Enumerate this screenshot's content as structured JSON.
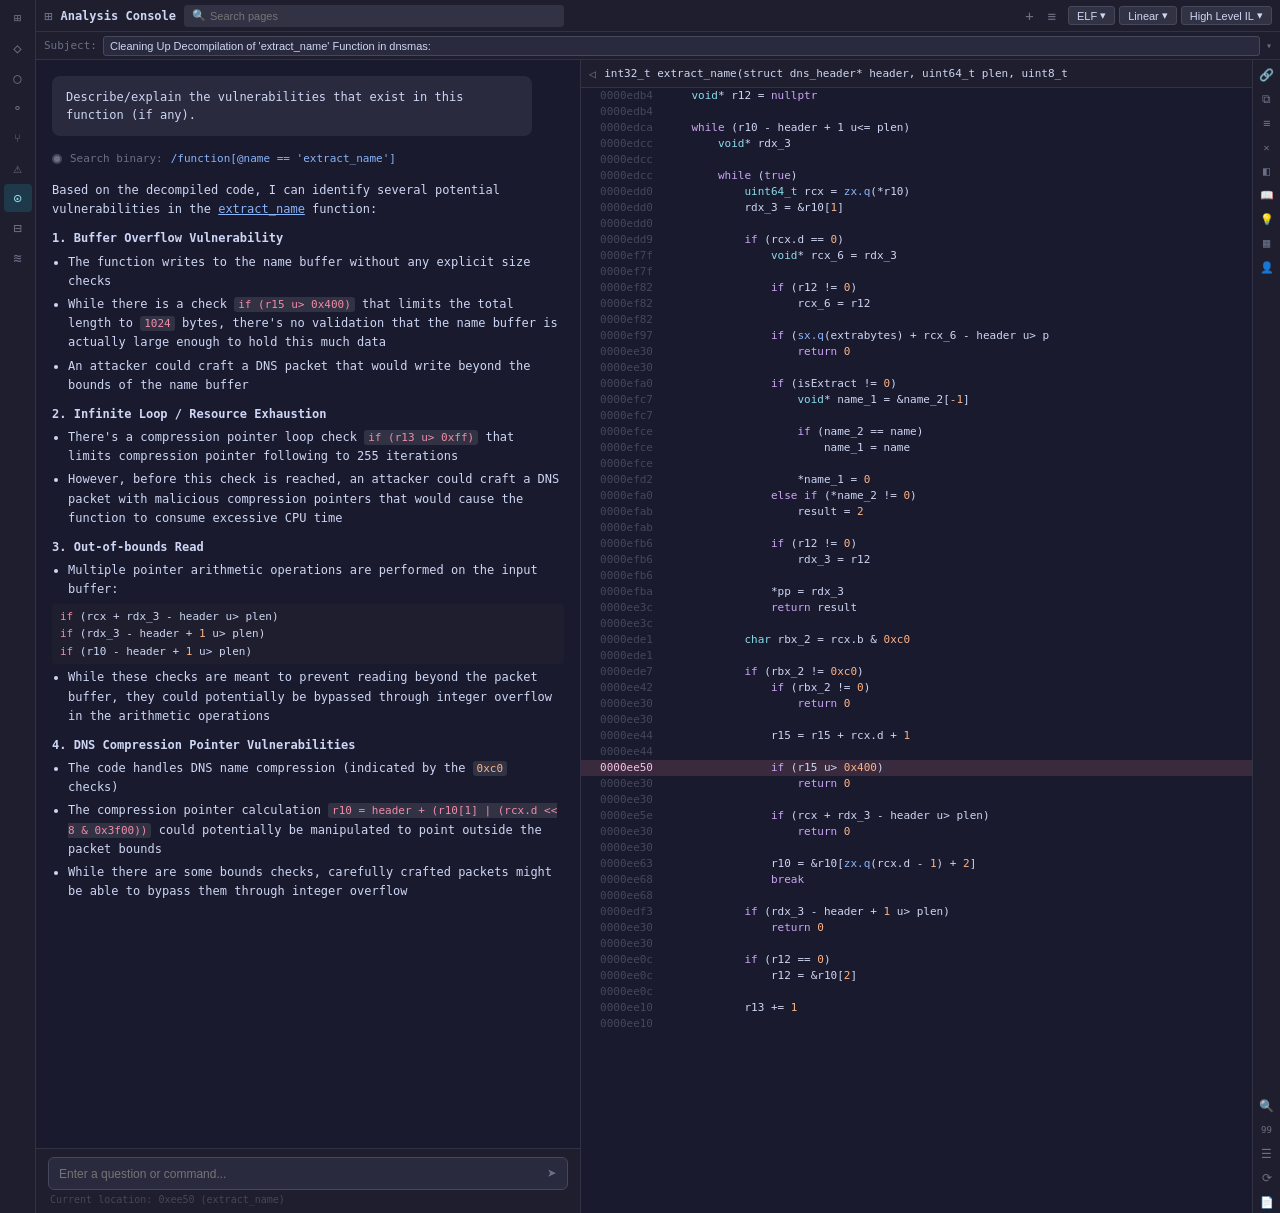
{
  "app": {
    "title": "Analysis Console",
    "search_placeholder": "Search pages"
  },
  "topbar": {
    "title": "Analysis Console",
    "search_placeholder": "Search pages",
    "tab_add": "+",
    "tab_menu": "≡",
    "elf_label": "ELF",
    "linear_label": "Linear",
    "highlevel_label": "High Level IL"
  },
  "subject": {
    "label": "Subject:",
    "value": "Cleaning Up Decompilation of 'extract_name' Function in dnsmas:"
  },
  "chat": {
    "bubble_text": "Describe/explain the vulnerabilities that exist in this function (if any).",
    "search_binary_text": "Search binary:",
    "search_query": "/function[@name == 'extract_name']",
    "response_intro": "Based on the decompiled code, I can identify several potential vulnerabilities in the",
    "func_name": "extract_name",
    "func_suffix": "function:",
    "sections": [
      {
        "num": "1.",
        "title": "Buffer Overflow Vulnerability",
        "bullets": [
          "The function writes to the name buffer without any explicit size checks",
          "While there is a check if (r15 u> 0x400) that limits the total length to 1024 bytes, there's no validation that the name buffer is actually large enough to hold this much data",
          "An attacker could craft a DNS packet that would write beyond the bounds of the name buffer"
        ]
      },
      {
        "num": "2.",
        "title": "Infinite Loop / Resource Exhaustion",
        "bullets": [
          "There's a compression pointer loop check if (r13 u> 0xff) that limits compression pointer following to 255 iterations",
          "However, before this check is reached, an attacker could craft a DNS packet with malicious compression pointers that would cause the function to consume excessive CPU time"
        ]
      },
      {
        "num": "3.",
        "title": "Out-of-bounds Read",
        "bullets": [
          "Multiple pointer arithmetic operations are performed on the input buffer:"
        ],
        "code_lines": [
          "if (rcx + rdx_3 - header u> plen)",
          "if (rdx_3 - header + 1 u> plen)",
          "if (r10 - header + 1 u> plen)"
        ],
        "extra_bullets": [
          "While these checks are meant to prevent reading beyond the packet buffer, they could potentially be bypassed through integer overflow in the arithmetic operations"
        ]
      },
      {
        "num": "4.",
        "title": "DNS Compression Pointer Vulnerabilities",
        "bullets": [
          "The code handles DNS name compression (indicated by the 0xc0 checks)",
          "The compression pointer calculation r10 = header + (r10[1] | (rcx.d << 8 & 0x3f00)) could potentially be manipulated to point outside the packet bounds",
          "While there are some bounds checks, carefully crafted packets might be able to bypass them through integer overflow"
        ]
      }
    ],
    "input_placeholder": "Enter a question or command...",
    "location_label": "Current location:",
    "location_value": "0xee50 (extract_name)"
  },
  "code_header": {
    "breadcrumb": "int32_t extract_name(struct dns_header* header, uint64_t plen, uint8_t"
  },
  "code_lines": [
    {
      "addr": "0000edb4",
      "content": "    void* r12 = nullptr",
      "highlight": false
    },
    {
      "addr": "0000edb4",
      "content": "",
      "highlight": false
    },
    {
      "addr": "0000edca",
      "content": "    while (r10 - header + 1 u<= plen)",
      "highlight": false
    },
    {
      "addr": "0000edcc",
      "content": "        void* rdx_3",
      "highlight": false
    },
    {
      "addr": "0000edcc",
      "content": "",
      "highlight": false
    },
    {
      "addr": "0000edcc",
      "content": "        while (true)",
      "highlight": false
    },
    {
      "addr": "0000edd0",
      "content": "            uint64_t rcx = zx.q(*r10)",
      "highlight": false
    },
    {
      "addr": "0000edd0",
      "content": "            rdx_3 = &r10[1]",
      "highlight": false
    },
    {
      "addr": "0000edd0",
      "content": "",
      "highlight": false
    },
    {
      "addr": "0000edd9",
      "content": "            if (rcx.d == 0)",
      "highlight": false
    },
    {
      "addr": "0000ef7f",
      "content": "                void* rcx_6 = rdx_3",
      "highlight": false
    },
    {
      "addr": "0000ef7f",
      "content": "",
      "highlight": false
    },
    {
      "addr": "0000ef82",
      "content": "                if (r12 != 0)",
      "highlight": false
    },
    {
      "addr": "0000ef82",
      "content": "                    rcx_6 = r12",
      "highlight": false
    },
    {
      "addr": "0000ef82",
      "content": "",
      "highlight": false
    },
    {
      "addr": "0000ef97",
      "content": "                if (sx.q(extrabytes) + rcx_6 - header u> p",
      "highlight": false
    },
    {
      "addr": "0000ee30",
      "content": "                    return 0",
      "highlight": false
    },
    {
      "addr": "0000ee30",
      "content": "",
      "highlight": false
    },
    {
      "addr": "0000efa0",
      "content": "                if (isExtract != 0)",
      "highlight": false
    },
    {
      "addr": "0000efc7",
      "content": "                    void* name_1 = &name_2[-1]",
      "highlight": false
    },
    {
      "addr": "0000efc7",
      "content": "",
      "highlight": false
    },
    {
      "addr": "0000efce",
      "content": "                    if (name_2 == name)",
      "highlight": false
    },
    {
      "addr": "0000efce",
      "content": "                        name_1 = name",
      "highlight": false
    },
    {
      "addr": "0000efce",
      "content": "",
      "highlight": false
    },
    {
      "addr": "0000efd2",
      "content": "                    *name_1 = 0",
      "highlight": false
    },
    {
      "addr": "0000efa0",
      "content": "                else if (*name_2 != 0)",
      "highlight": false
    },
    {
      "addr": "0000efab",
      "content": "                    result = 2",
      "highlight": false
    },
    {
      "addr": "0000efab",
      "content": "",
      "highlight": false
    },
    {
      "addr": "0000efb6",
      "content": "                if (r12 != 0)",
      "highlight": false
    },
    {
      "addr": "0000efb6",
      "content": "                    rdx_3 = r12",
      "highlight": false
    },
    {
      "addr": "0000efb6",
      "content": "",
      "highlight": false
    },
    {
      "addr": "0000efba",
      "content": "                *pp = rdx_3",
      "highlight": false
    },
    {
      "addr": "0000ee3c",
      "content": "                return result",
      "highlight": false
    },
    {
      "addr": "0000ee3c",
      "content": "",
      "highlight": false
    },
    {
      "addr": "0000ede1",
      "content": "            char rbx_2 = rcx.b & 0xc0",
      "highlight": false
    },
    {
      "addr": "0000ede1",
      "content": "",
      "highlight": false
    },
    {
      "addr": "0000ede7",
      "content": "            if (rbx_2 != 0xc0)",
      "highlight": false
    },
    {
      "addr": "0000ee42",
      "content": "                if (rbx_2 != 0)",
      "highlight": false
    },
    {
      "addr": "0000ee30",
      "content": "                    return 0",
      "highlight": false
    },
    {
      "addr": "0000ee30",
      "content": "",
      "highlight": false
    },
    {
      "addr": "0000ee44",
      "content": "                r15 = r15 + rcx.d + 1",
      "highlight": false
    },
    {
      "addr": "0000ee44",
      "content": "",
      "highlight": false
    },
    {
      "addr": "0000ee50",
      "content": "                if (r15 u> 0x400)",
      "highlight": true
    },
    {
      "addr": "0000ee30",
      "content": "                    return 0",
      "highlight": false
    },
    {
      "addr": "0000ee30",
      "content": "",
      "highlight": false
    },
    {
      "addr": "0000ee5e",
      "content": "                if (rcx + rdx_3 - header u> plen)",
      "highlight": false
    },
    {
      "addr": "0000ee30",
      "content": "                    return 0",
      "highlight": false
    },
    {
      "addr": "0000ee30",
      "content": "",
      "highlight": false
    },
    {
      "addr": "0000ee63",
      "content": "                r10 = &r10[zx.q(rcx.d - 1) + 2]",
      "highlight": false
    },
    {
      "addr": "0000ee68",
      "content": "                break",
      "highlight": false
    },
    {
      "addr": "0000ee68",
      "content": "",
      "highlight": false
    },
    {
      "addr": "0000edf3",
      "content": "            if (rdx_3 - header + 1 u> plen)",
      "highlight": false
    },
    {
      "addr": "0000ee30",
      "content": "                return 0",
      "highlight": false
    },
    {
      "addr": "0000ee30",
      "content": "",
      "highlight": false
    },
    {
      "addr": "0000ee0c",
      "content": "            if (r12 == 0)",
      "highlight": false
    },
    {
      "addr": "0000ee0c",
      "content": "                r12 = &r10[2]",
      "highlight": false
    },
    {
      "addr": "0000ee0c",
      "content": "",
      "highlight": false
    },
    {
      "addr": "0000ee10",
      "content": "            r13 += 1",
      "highlight": false
    },
    {
      "addr": "0000ee10",
      "content": "",
      "highlight": false
    }
  ],
  "sidebar_left": {
    "icons": [
      {
        "name": "grid-icon",
        "symbol": "⊞",
        "active": false
      },
      {
        "name": "diamond-icon",
        "symbol": "◇",
        "active": false
      },
      {
        "name": "circle-icon",
        "symbol": "○",
        "active": false
      },
      {
        "name": "person-icon",
        "symbol": "⚬",
        "active": false
      },
      {
        "name": "branch-icon",
        "symbol": "⑂",
        "active": false
      },
      {
        "name": "bug-icon",
        "symbol": "⚠",
        "active": false
      },
      {
        "name": "robot-icon",
        "symbol": "⊙",
        "active": true
      },
      {
        "name": "table-icon",
        "symbol": "⊟",
        "active": false
      },
      {
        "name": "layers-icon",
        "symbol": "≋",
        "active": false
      }
    ]
  },
  "sidebar_right": {
    "icons": [
      {
        "name": "link-icon",
        "symbol": "🔗",
        "active": false
      },
      {
        "name": "copy-icon",
        "symbol": "⧉",
        "active": false
      },
      {
        "name": "menu-icon",
        "symbol": "≡",
        "active": false
      },
      {
        "name": "x-icon",
        "symbol": "✕",
        "active": false
      },
      {
        "name": "layers2-icon",
        "symbol": "◧",
        "active": false
      },
      {
        "name": "book-icon",
        "symbol": "📖",
        "active": false
      },
      {
        "name": "bulb-icon",
        "symbol": "💡",
        "active": false
      },
      {
        "name": "grid2-icon",
        "symbol": "▦",
        "active": false
      },
      {
        "name": "user2-icon",
        "symbol": "👤",
        "active": false
      },
      {
        "name": "search2-icon",
        "symbol": "🔍",
        "active": false
      },
      {
        "name": "num-icon",
        "symbol": "99",
        "active": false
      },
      {
        "name": "list-icon",
        "symbol": "☰",
        "active": false
      },
      {
        "name": "history-icon",
        "symbol": "⟳",
        "active": false
      },
      {
        "name": "doc-icon",
        "symbol": "📄",
        "active": false
      }
    ]
  }
}
